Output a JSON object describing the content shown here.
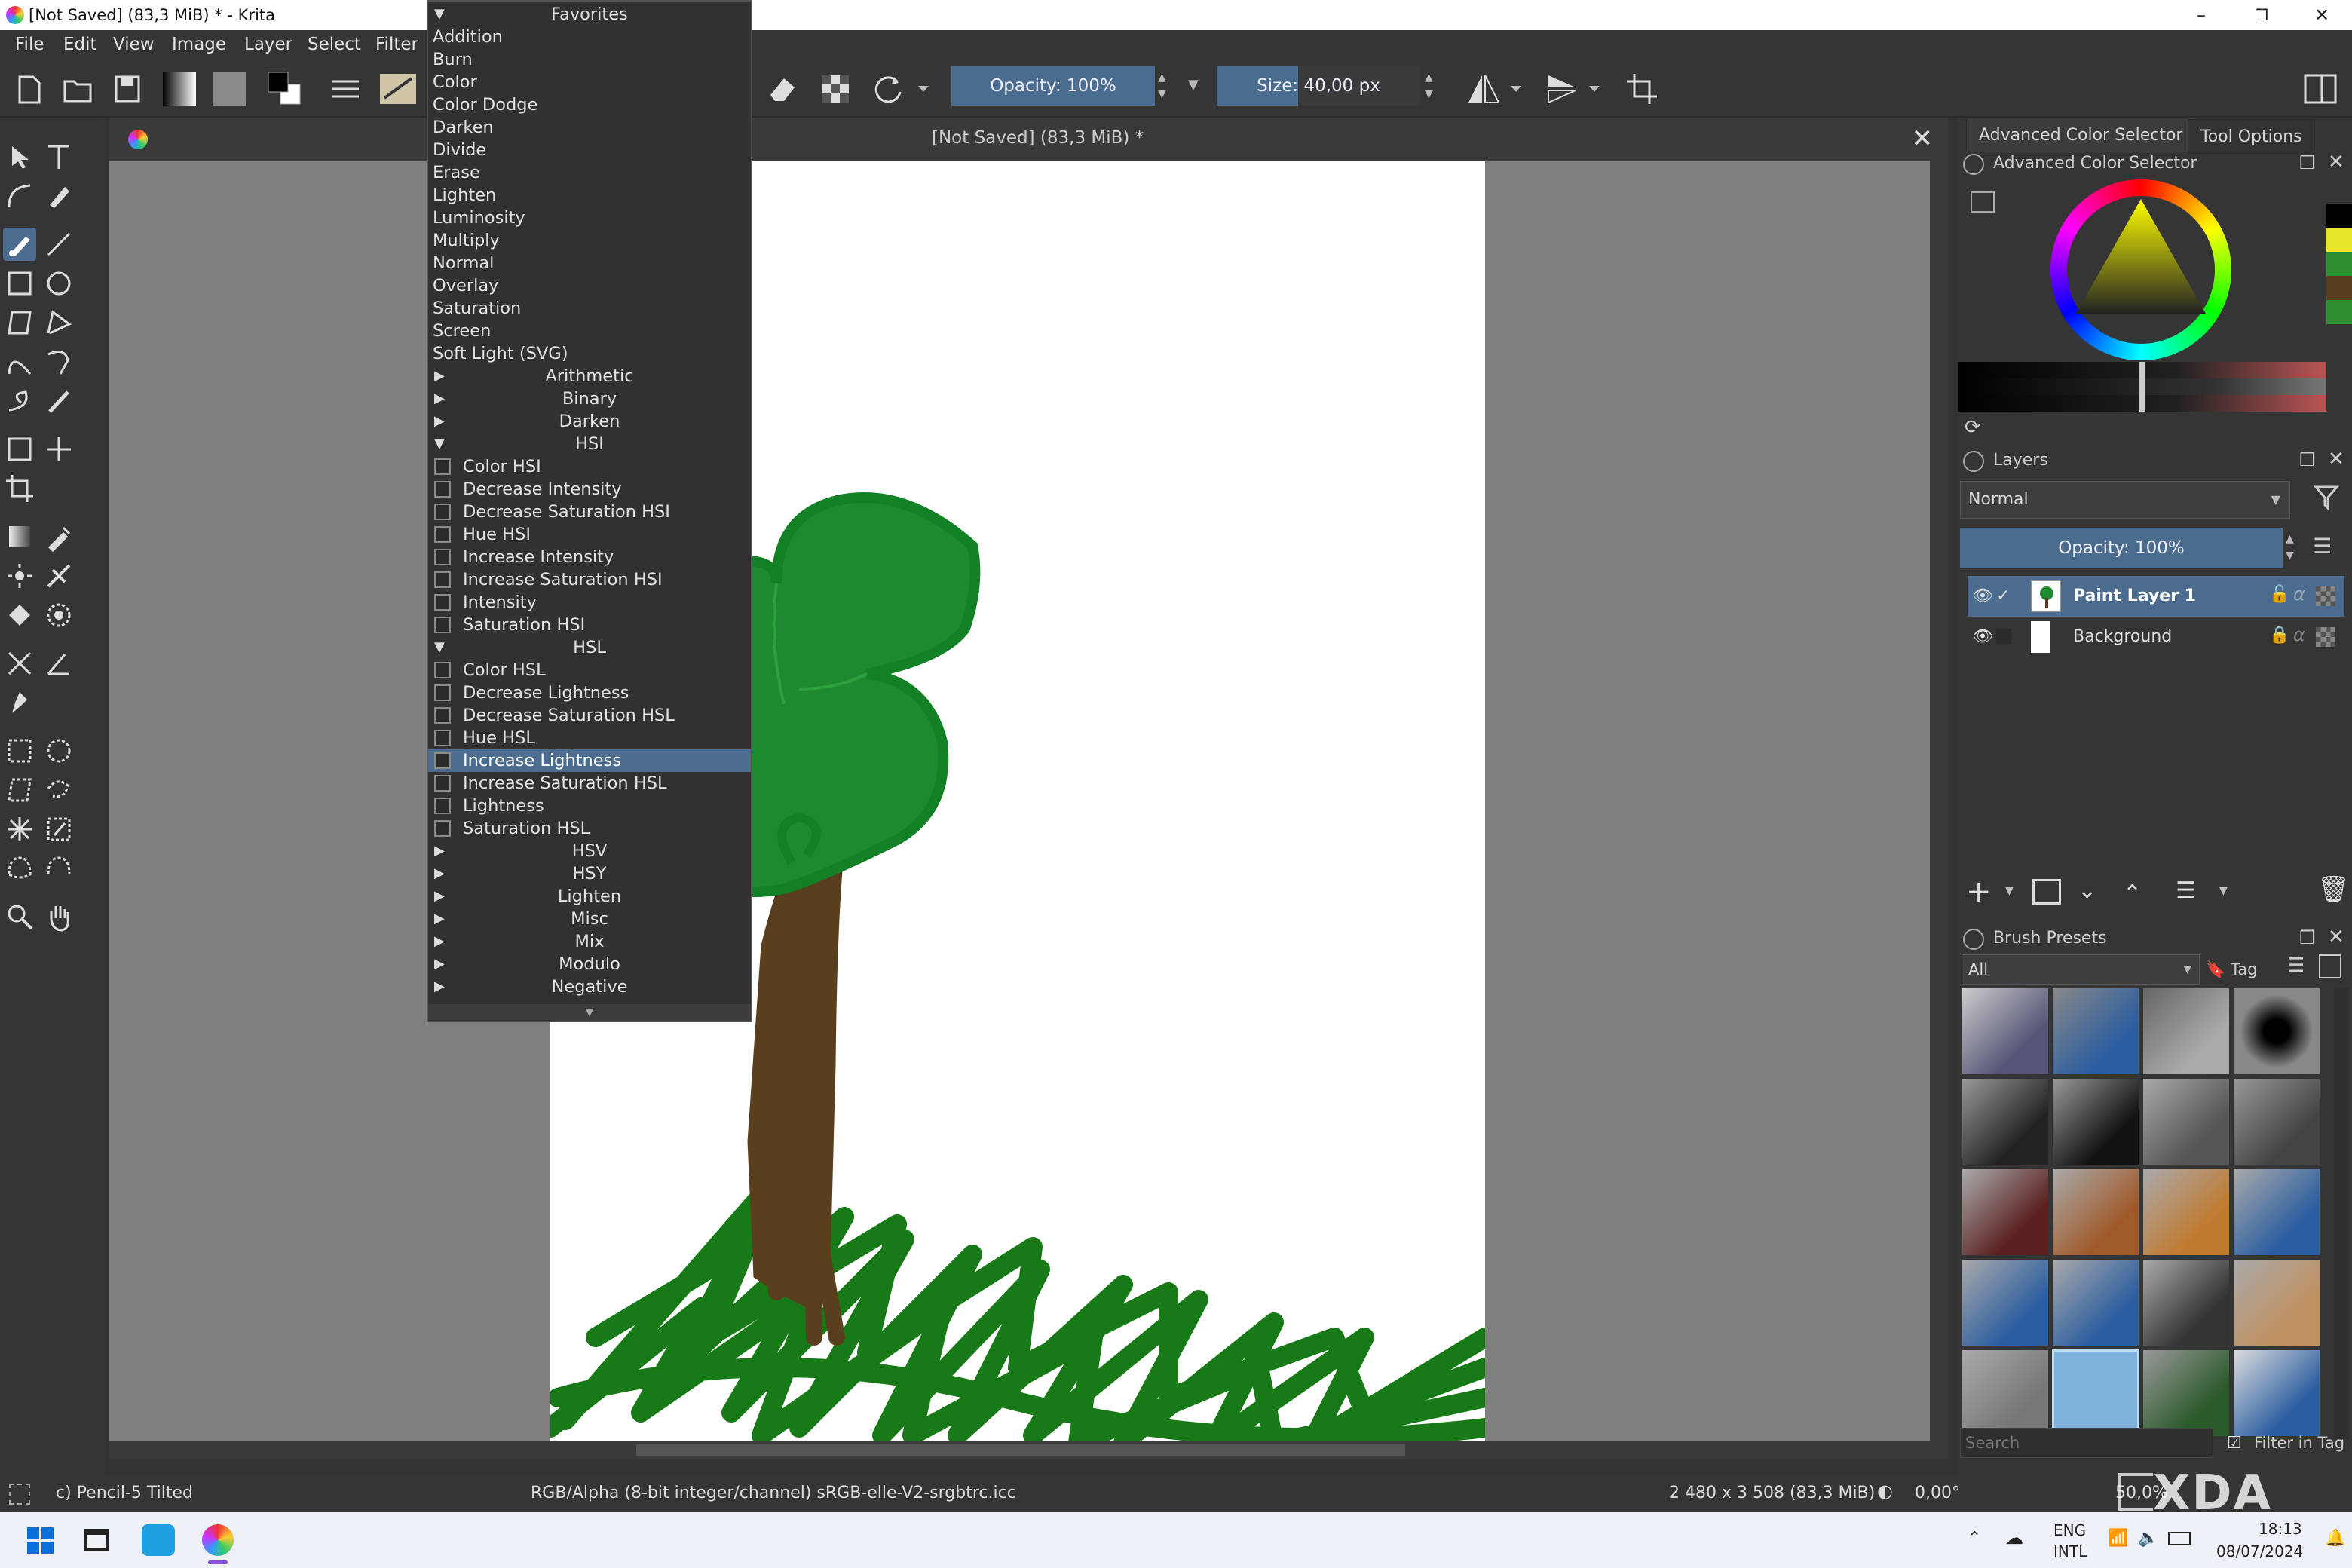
{
  "window": {
    "title": "[Not Saved]  (83,3 MiB) * - Krita"
  },
  "menubar": {
    "items": [
      "File",
      "Edit",
      "View",
      "Image",
      "Layer",
      "Select",
      "Filter"
    ]
  },
  "toolbar": {
    "opacity_label": "Opacity: 100%",
    "size_label": "Size: 40,00 px"
  },
  "canvas": {
    "tab_title": "[Not Saved]  (83,3 MiB) *"
  },
  "blend_dropdown": {
    "header": "Favorites",
    "favorites": [
      "Addition",
      "Burn",
      "Color",
      "Color Dodge",
      "Darken",
      "Divide",
      "Erase",
      "Lighten",
      "Luminosity",
      "Multiply",
      "Normal",
      "Overlay",
      "Saturation",
      "Screen",
      "Soft Light (SVG)"
    ],
    "collapsed_categories_1": [
      "Arithmetic",
      "Binary",
      "Darken"
    ],
    "hsi_header": "HSI",
    "hsi_items": [
      "Color HSI",
      "Decrease Intensity",
      "Decrease Saturation HSI",
      "Hue HSI",
      "Increase Intensity",
      "Increase Saturation HSI",
      "Intensity",
      "Saturation HSI"
    ],
    "hsl_header": "HSL",
    "hsl_items": [
      "Color HSL",
      "Decrease Lightness",
      "Decrease Saturation HSL",
      "Hue HSL",
      "Increase Lightness",
      "Increase Saturation HSL",
      "Lightness",
      "Saturation HSL"
    ],
    "selected_item": "Increase Lightness",
    "collapsed_categories_2": [
      "HSV",
      "HSY",
      "Lighten",
      "Misc",
      "Mix",
      "Modulo",
      "Negative"
    ]
  },
  "right_panel": {
    "tab_color_selector": "Advanced Color Selector",
    "tab_tool_options": "Tool Options",
    "color_selector_title": "Advanced Color Selector",
    "layers_title": "Layers",
    "blend_mode": "Normal",
    "layers_opacity": "Opacity:  100%",
    "layers": [
      {
        "name": "Paint Layer 1",
        "active": true
      },
      {
        "name": "Background",
        "active": false
      }
    ],
    "brush_presets_title": "Brush Presets",
    "brush_filter": "All",
    "tag_label": "Tag",
    "search_placeholder": "Search",
    "filter_in_tag": "Filter in Tag"
  },
  "statusbar": {
    "brush_name": "c) Pencil-5 Tilted",
    "color_space": "RGB/Alpha (8-bit integer/channel)  sRGB-elle-V2-srgbtrc.icc",
    "dimensions": "2 480 x 3 508 (83,3 MiB)",
    "rotation": "0,00°",
    "zoom": "50,0%"
  },
  "taskbar": {
    "lang_top": "ENG",
    "lang_bottom": "INTL",
    "time": "18:13",
    "date": "08/07/2024",
    "watermark": "XDA"
  },
  "colors": {
    "accent": "#4b6c8e",
    "tree_green": "#1e8a2f",
    "trunk_brown": "#5a3f1f",
    "grass_green": "#177a17"
  }
}
